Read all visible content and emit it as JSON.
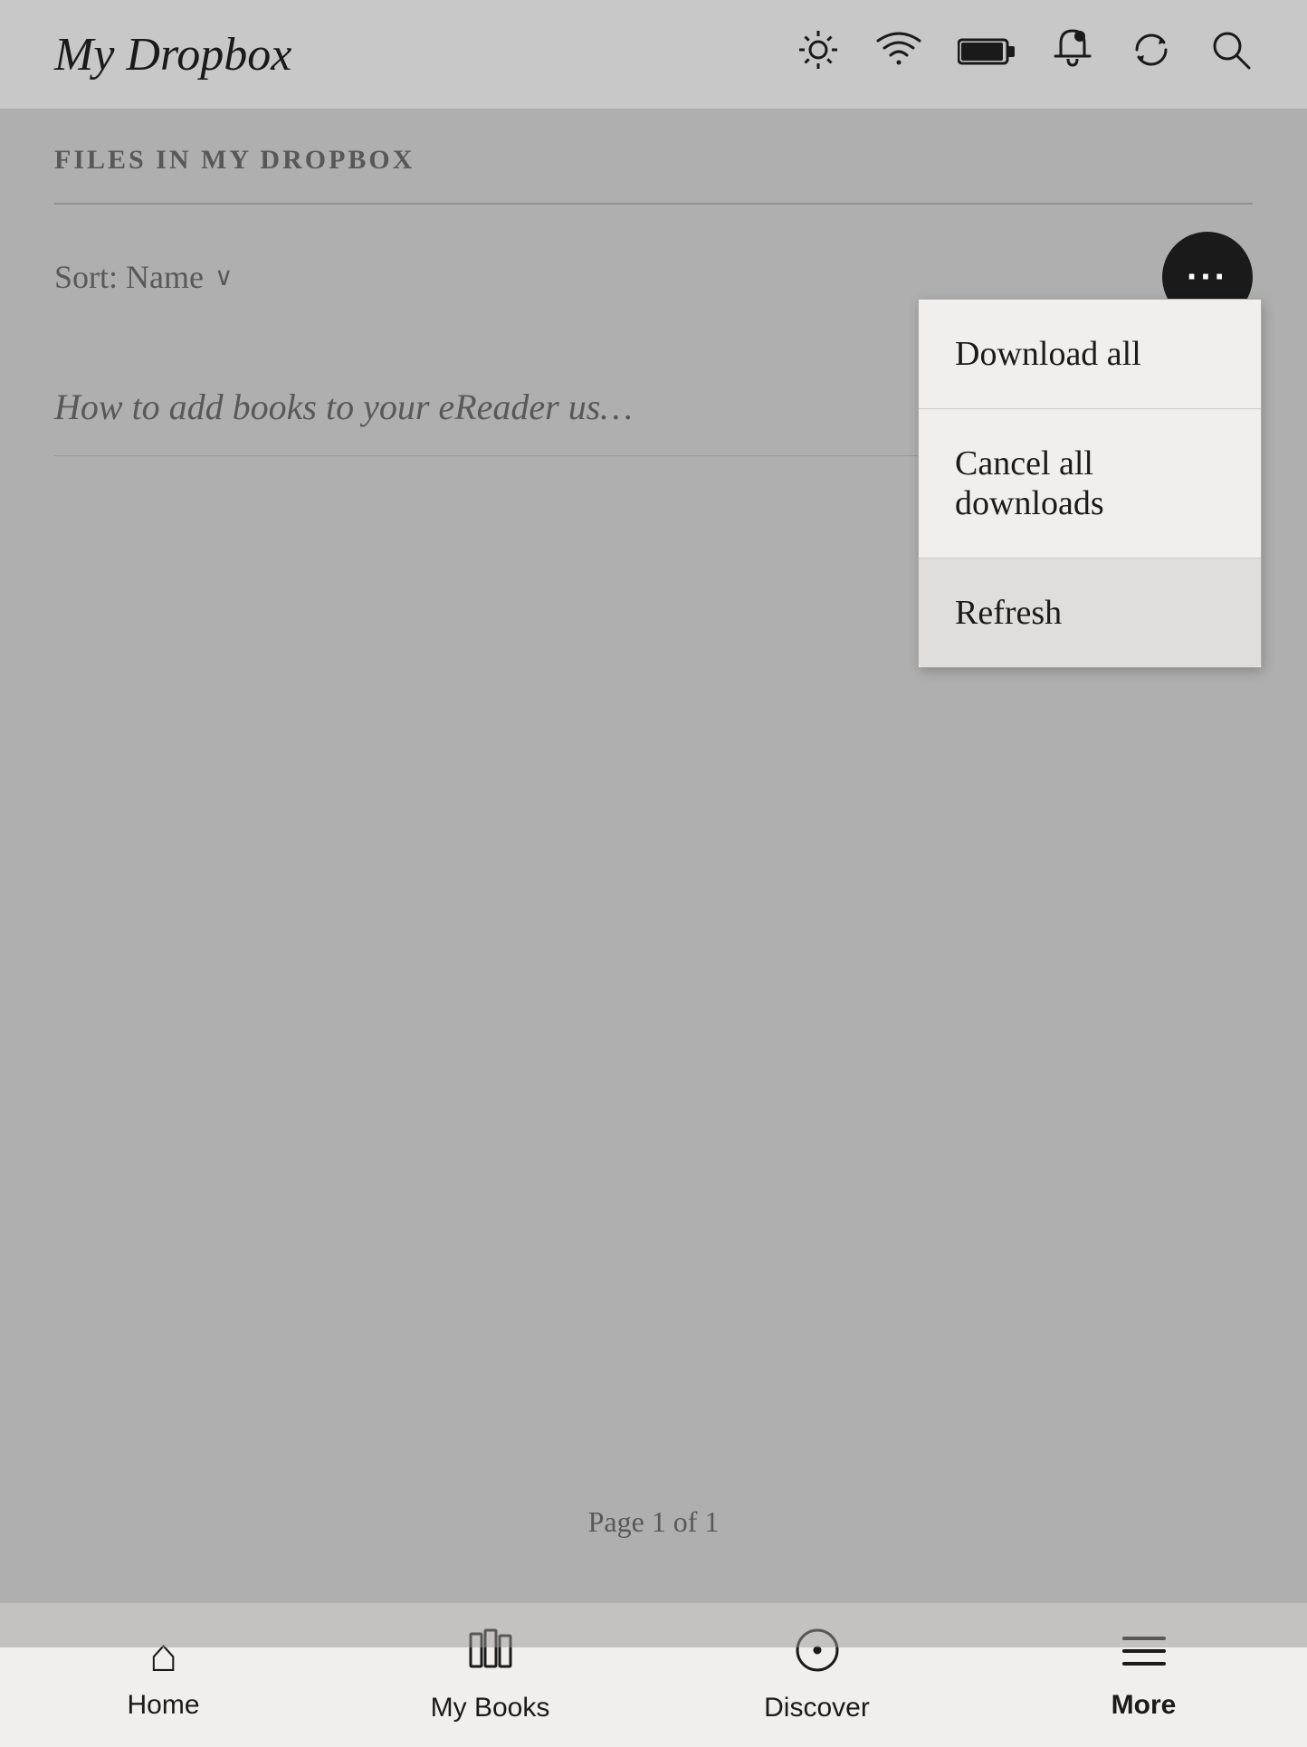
{
  "header": {
    "title": "My Dropbox",
    "icons": [
      "brightness-icon",
      "wifi-icon",
      "battery-icon",
      "notification-icon",
      "sync-icon",
      "search-icon"
    ]
  },
  "section": {
    "title": "FILES IN MY DROPBOX",
    "sort_label": "Sort: Name"
  },
  "more_button": {
    "label": "···"
  },
  "dropdown": {
    "items": [
      {
        "label": "Download all"
      },
      {
        "label": "Cancel all downloads"
      },
      {
        "label": "Refresh"
      }
    ]
  },
  "file_list": [
    {
      "title": "How to add books to your eReader us…"
    }
  ],
  "pagination": {
    "text": "Page 1 of 1"
  },
  "bottom_nav": {
    "items": [
      {
        "label": "Home",
        "icon": "⌂"
      },
      {
        "label": "My Books",
        "icon": "📚"
      },
      {
        "label": "Discover",
        "icon": "◎"
      },
      {
        "label": "More",
        "icon": "☰"
      }
    ]
  }
}
